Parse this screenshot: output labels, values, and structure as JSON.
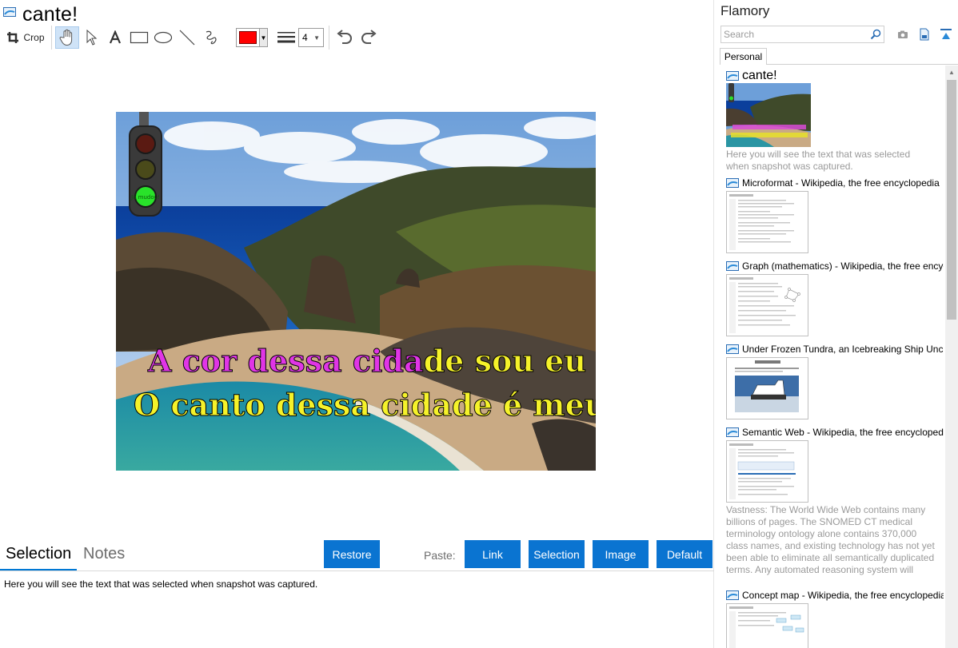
{
  "window": {
    "title": "cante!"
  },
  "toolbar": {
    "crop_label": "Crop",
    "stroke_width": "4",
    "stroke_color": "#ff0000"
  },
  "image": {
    "lyric_line1_highlight": "A cor dessa cida",
    "lyric_line1_rest": "de sou eu",
    "lyric_line2": "O canto dessa cidade é meu",
    "traffic_light_label": "Já mudou!"
  },
  "bottom": {
    "tabs": {
      "selection": "Selection",
      "notes": "Notes"
    },
    "restore_label": "Restore",
    "paste_label": "Paste:",
    "paste_buttons": {
      "link": "Link",
      "selection": "Selection",
      "image": "Image",
      "default": "Default"
    },
    "selection_text": "Here you will see the text that was selected when snapshot was captured."
  },
  "sidebar": {
    "title": "Flamory",
    "search_placeholder": "Search",
    "tab_personal": "Personal",
    "items": [
      {
        "title": "cante!",
        "desc": "Here you will see the text that was selected when snapshot was captured."
      },
      {
        "title": "Microformat - Wikipedia, the free encyclopedia"
      },
      {
        "title": "Graph (mathematics) - Wikipedia, the free encyclopedia"
      },
      {
        "title": "Under Frozen Tundra, an Icebreaking Ship Uncovers Riches"
      },
      {
        "title": "Semantic Web - Wikipedia, the free encyclopedia",
        "desc": "Vastness: The World Wide Web contains many billions of pages. The SNOMED CT medical terminology ontology alone contains 370,000 class names, and existing technology has not yet been able to eliminate all semantically duplicated terms. Any automated reasoning system will have to deal with truly huge inputs."
      },
      {
        "title": "Concept map - Wikipedia, the free encyclopedia"
      }
    ]
  },
  "colors": {
    "accent": "#0a74d1",
    "muted_text": "#9a9a9a"
  }
}
